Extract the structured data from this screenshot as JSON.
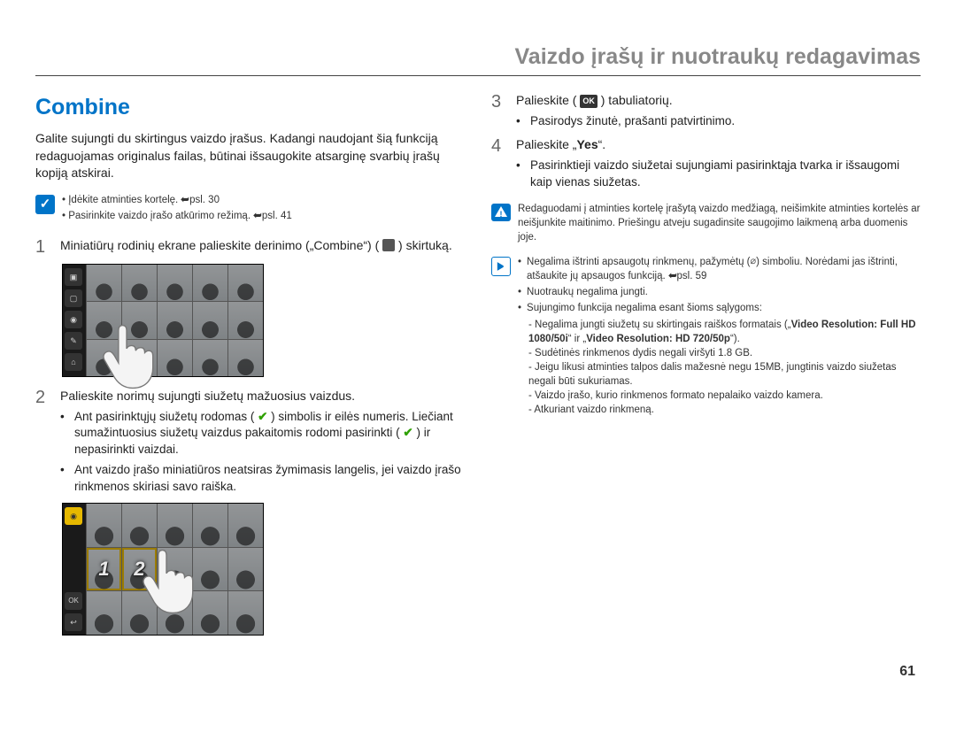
{
  "chapter_title": "Vaizdo įrašų ir nuotraukų redagavimas",
  "section_title": "Combine",
  "intro": "Galite sujungti du skirtingus vaizdo įrašus. Kadangi naudojant šią funkciją redaguojamas originalus failas, būtinai išsaugokite atsarginę svarbių įrašų kopiją atskirai.",
  "precheck": {
    "items": [
      {
        "text": "Įdėkite atminties kortelę.",
        "ref": "psl. 30"
      },
      {
        "text": "Pasirinkite vaizdo įrašo atkūrimo režimą.",
        "ref": "psl. 41"
      }
    ]
  },
  "steps_left": [
    {
      "num": "1",
      "text": "Miniatiūrų rodinių ekrane palieskite derinimo („Combine“) ( ",
      "text_after": " ) skirtuką."
    },
    {
      "num": "2",
      "text": "Palieskite norimų sujungti siužetų mažuosius vaizdus.",
      "subs": [
        {
          "pre": "Ant pasirinktųjų siužetų rodomas ( ",
          "post": " ) simbolis ir eilės numeris. Liečiant sumažintuosius siužetų vaizdus pakaitomis rodomi pasirinkti ( ",
          "post2": " ) ir nepasirinkti vaizdai."
        },
        {
          "text": "Ant vaizdo įrašo miniatiūros neatsiras žymimasis langelis, jei vaizdo įrašo rinkmenos skiriasi savo raiška."
        }
      ]
    }
  ],
  "steps_right": [
    {
      "num": "3",
      "text_pre": "Palieskite ( ",
      "text_post": " ) tabuliatorių.",
      "sub": "Pasirodys žinutė, prašanti patvirtinimo."
    },
    {
      "num": "4",
      "text_pre": "Palieskite „",
      "yes": "Yes",
      "text_post": "“.",
      "sub": "Pasirinktieji vaizdo siužetai sujungiami pasirinktąja tvarka ir išsaugomi kaip vienas siužetas."
    }
  ],
  "caution": "Redaguodami į atminties kortelę įrašytą vaizdo medžiagą, neišimkite atminties kortelės ar neišjunkite maitinimo. Priešingu atveju sugadinsite saugojimo laikmeną arba duomenis joje.",
  "info_notes": {
    "items": [
      {
        "text_pre": "Negalima ištrinti apsaugotų rinkmenų, pažymėtų (",
        "text_post": ") simboliu. Norėdami jas ištrinti, atšaukite jų apsaugos funkciją.",
        "ref": "psl. 59"
      },
      {
        "text": "Nuotraukų negalima jungti."
      },
      {
        "text": "Sujungimo funkcija negalima esant šioms sąlygoms:"
      }
    ],
    "dashes": [
      "Negalima jungti siužetų su skirtingais raiškos formatais („Video Resolution: Full HD 1080/50i“ ir „Video Resolution: HD 720/50p“).",
      "Sudėtinės rinkmenos dydis negali viršyti 1.8 GB.",
      "Jeigu likusi atminties talpos dalis mažesnė negu 15MB, jungtinis vaizdo siužetas negali būti sukuriamas.",
      "Vaizdo įrašo, kurio rinkmenos formato nepalaiko vaizdo kamera.",
      "Atkuriant vaizdo rinkmeną."
    ],
    "dash_bold_segment": "Video Resolution: Full HD 1080/50i“ ir „Video Resolution: HD 720/50p"
  },
  "side_buttons_first": [
    "▣",
    "▢",
    "◉",
    "✎",
    "⌂"
  ],
  "side_buttons_second_top": [
    "◉"
  ],
  "side_buttons_second_bot": [
    "OK",
    "↩"
  ],
  "ok_label": "OK",
  "page_number": "61"
}
